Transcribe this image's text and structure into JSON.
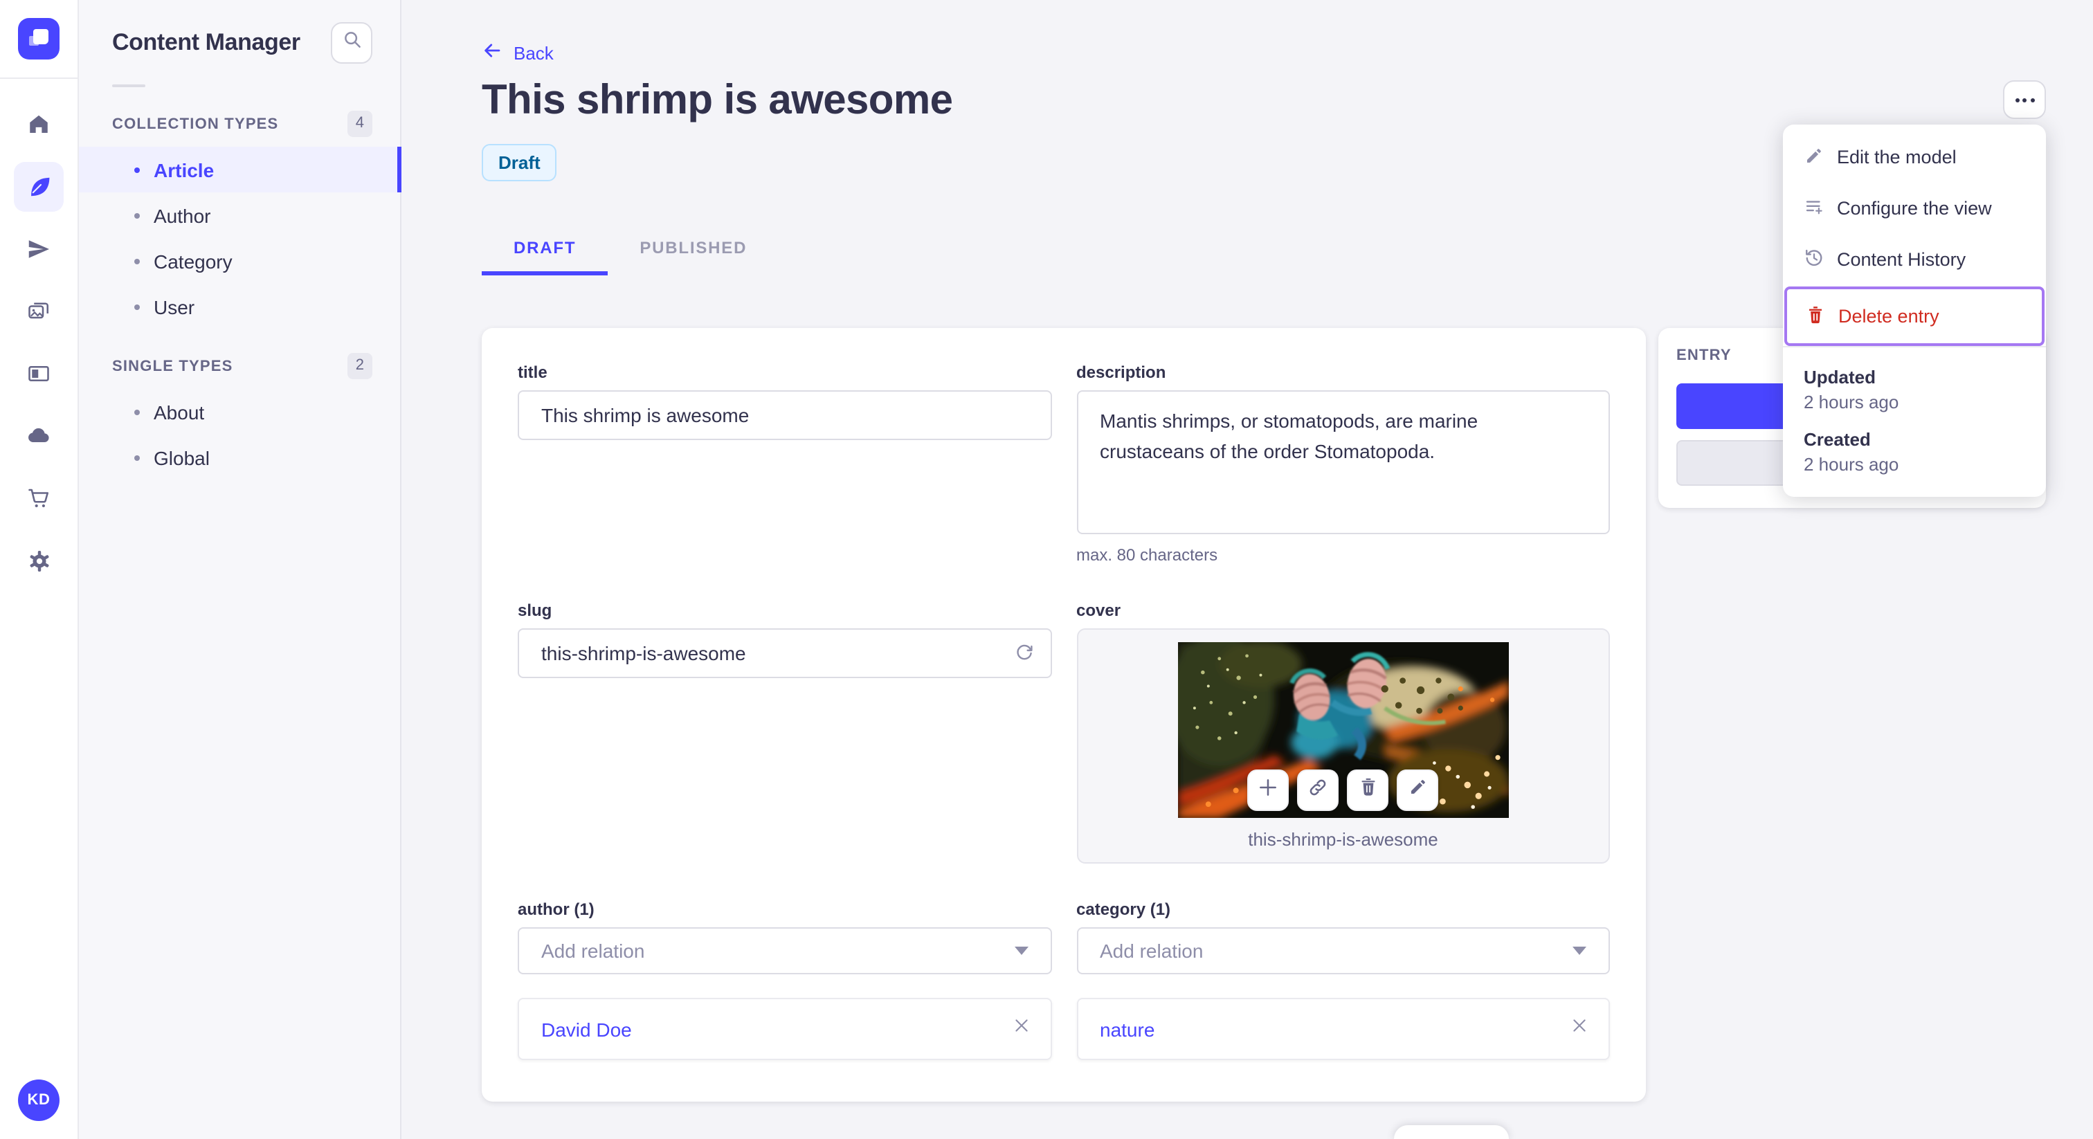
{
  "colors": {
    "primary": "#4945ff",
    "danger": "#d02b20",
    "focus_ring": "#a578f2",
    "draft_badge_bg": "#eaf5ff",
    "draft_badge_text": "#006096"
  },
  "rail": {
    "logo_icon": "strapi-logo",
    "items": [
      {
        "icon": "home-icon",
        "active": false
      },
      {
        "icon": "feather-icon",
        "active": true
      },
      {
        "icon": "paper-plane-icon",
        "active": false
      },
      {
        "icon": "media-library-icon",
        "active": false
      },
      {
        "icon": "content-type-builder-icon",
        "active": false
      },
      {
        "icon": "cloud-icon",
        "active": false
      },
      {
        "icon": "marketplace-cart-icon",
        "active": false
      },
      {
        "icon": "settings-gear-icon",
        "active": false
      }
    ],
    "avatar_initials": "KD"
  },
  "subnav": {
    "title": "Content Manager",
    "search_icon": "search-icon",
    "sections": [
      {
        "label": "COLLECTION TYPES",
        "count": "4",
        "items": [
          {
            "label": "Article",
            "active": true
          },
          {
            "label": "Author",
            "active": false
          },
          {
            "label": "Category",
            "active": false
          },
          {
            "label": "User",
            "active": false
          }
        ]
      },
      {
        "label": "SINGLE TYPES",
        "count": "2",
        "items": [
          {
            "label": "About",
            "active": false
          },
          {
            "label": "Global",
            "active": false
          }
        ]
      }
    ]
  },
  "header": {
    "back_label": "Back",
    "title": "This shrimp is awesome",
    "status_badge": "Draft",
    "tabs": [
      {
        "label": "DRAFT",
        "active": true
      },
      {
        "label": "PUBLISHED",
        "active": false
      }
    ]
  },
  "form": {
    "title_field": {
      "label": "title",
      "value": "This shrimp is awesome"
    },
    "description_field": {
      "label": "description",
      "value": "Mantis shrimps, or stomatopods, are marine crustaceans of the order Stomatopoda.",
      "hint": "max. 80 characters"
    },
    "slug_field": {
      "label": "slug",
      "value": "this-shrimp-is-awesome",
      "icon": "regenerate-icon"
    },
    "cover_field": {
      "label": "cover",
      "filename": "this-shrimp-is-awesome",
      "actions": [
        "add-icon",
        "link-icon",
        "trash-icon",
        "pencil-icon"
      ]
    },
    "author_field": {
      "label": "author (1)",
      "placeholder": "Add relation",
      "relations": [
        {
          "name": "David Doe"
        }
      ]
    },
    "category_field": {
      "label": "category (1)",
      "placeholder": "Add relation",
      "relations": [
        {
          "name": "nature"
        }
      ]
    }
  },
  "entry_panel": {
    "title": "ENTRY"
  },
  "context_menu": {
    "items": [
      {
        "label": "Edit the model",
        "icon": "pencil-icon",
        "danger": false,
        "focused": false
      },
      {
        "label": "Configure the view",
        "icon": "configure-list-icon",
        "danger": false,
        "focused": false
      },
      {
        "label": "Content History",
        "icon": "history-icon",
        "danger": false,
        "focused": false
      },
      {
        "label": "Delete entry",
        "icon": "trash-icon",
        "danger": true,
        "focused": true
      }
    ],
    "meta": [
      {
        "label": "Updated",
        "value": "2 hours ago"
      },
      {
        "label": "Created",
        "value": "2 hours ago"
      }
    ]
  }
}
